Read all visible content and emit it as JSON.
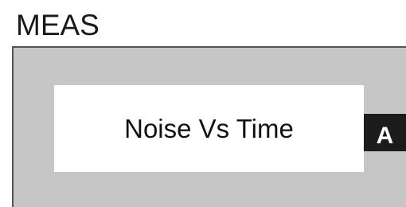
{
  "header": {
    "title": "MEAS"
  },
  "panel": {
    "mode_label": "Noise Vs Time",
    "channel_label": "A"
  },
  "colors": {
    "panel_background": "#c6c6c6",
    "panel_border": "#555555",
    "button_background": "#ffffff",
    "channel_tag_background": "#1c1c1c",
    "text": "#111111"
  }
}
